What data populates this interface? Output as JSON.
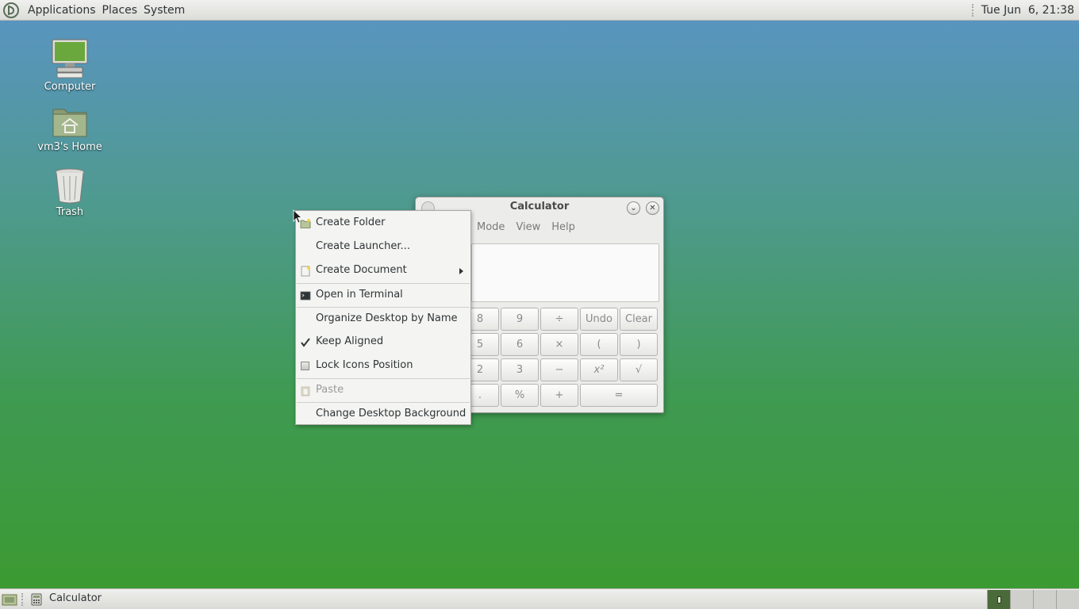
{
  "top_panel": {
    "menus": [
      "Applications",
      "Places",
      "System"
    ],
    "clock": "Tue Jun  6, 21:38"
  },
  "desktop": {
    "icons": [
      {
        "label": "Computer",
        "icon": "computer-icon"
      },
      {
        "label": "vm3's Home",
        "icon": "home-folder-icon"
      },
      {
        "label": "Trash",
        "icon": "trash-icon"
      }
    ]
  },
  "calculator": {
    "title": "Calculator",
    "menus": [
      "Mode",
      "View",
      "Help"
    ],
    "buttons": [
      "8",
      "9",
      "÷",
      "Undo",
      "Clear",
      "5",
      "6",
      "×",
      "(",
      ")",
      "2",
      "3",
      "−",
      "x²",
      "√",
      ".",
      "%",
      "+",
      "="
    ]
  },
  "context_menu": {
    "items": [
      {
        "label": "Create Folder",
        "icon": "folder-icon"
      },
      {
        "label": "Create Launcher...",
        "icon": ""
      },
      {
        "label": "Create Document",
        "icon": "document-icon",
        "submenu": true
      },
      {
        "label": "Open in Terminal",
        "icon": "terminal-icon"
      },
      {
        "label": "Organize Desktop by Name",
        "icon": ""
      },
      {
        "label": "Keep Aligned",
        "checked": true
      },
      {
        "label": "Lock Icons Position",
        "checked": false
      },
      {
        "label": "Paste",
        "icon": "paste-icon",
        "disabled": true
      },
      {
        "label": "Change Desktop Background",
        "icon": ""
      }
    ]
  },
  "bottom_panel": {
    "task_label": "Calculator",
    "workspaces": 4,
    "active_workspace": 1
  },
  "colors": {
    "desktop_top": "#5a94c4",
    "desktop_bottom": "#3c9a2e",
    "panel": "#e4e4e0"
  }
}
